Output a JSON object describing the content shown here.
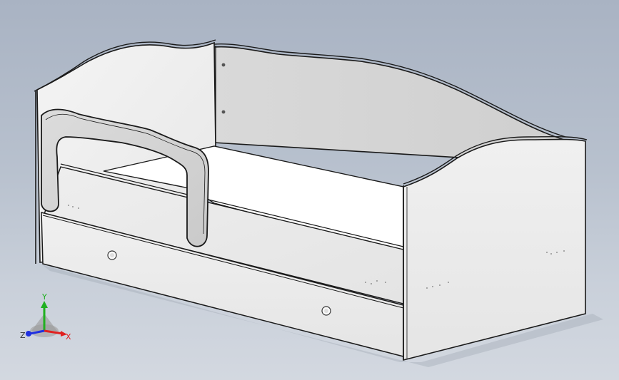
{
  "viewport": {
    "background_top": "#a9b3c3",
    "background_bottom": "#d3d8e0"
  },
  "model": {
    "name": "bed-assembly",
    "colors": {
      "panel_light": "#f2f2f2",
      "panel_mid": "#e2e2e2",
      "panel_dark": "#cfcfcf",
      "edge": "#1a1a1a",
      "mattress": "#ffffff",
      "rail": "#d6d6d6"
    },
    "icons": [
      "drawer-knob-icon",
      "screw-hole-icon"
    ]
  },
  "triad": {
    "x_label": "X",
    "y_label": "Y",
    "z_label": "Z",
    "x_color": "#e02020",
    "y_color": "#20b020",
    "z_color": "#2030e0"
  }
}
